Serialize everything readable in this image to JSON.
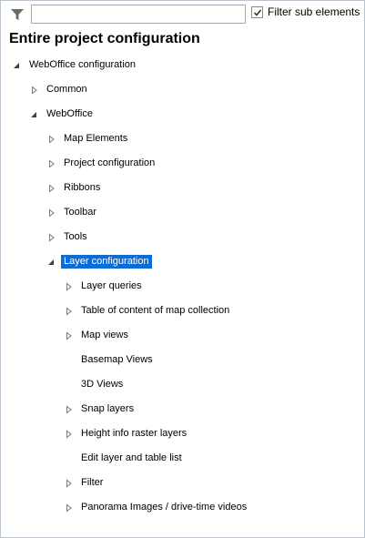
{
  "filter": {
    "placeholder": "",
    "value": "",
    "sub_elements_label": "Filter sub elements",
    "sub_elements_checked": true
  },
  "heading": "Entire project configuration",
  "tree": [
    {
      "label": "WebOffice configuration",
      "depth": 0,
      "state": "expanded",
      "selected": false
    },
    {
      "label": "Common",
      "depth": 1,
      "state": "collapsed",
      "selected": false
    },
    {
      "label": "WebOffice",
      "depth": 1,
      "state": "expanded",
      "selected": false
    },
    {
      "label": "Map Elements",
      "depth": 2,
      "state": "collapsed",
      "selected": false
    },
    {
      "label": "Project configuration",
      "depth": 2,
      "state": "collapsed",
      "selected": false
    },
    {
      "label": "Ribbons",
      "depth": 2,
      "state": "collapsed",
      "selected": false
    },
    {
      "label": "Toolbar",
      "depth": 2,
      "state": "collapsed",
      "selected": false
    },
    {
      "label": "Tools",
      "depth": 2,
      "state": "collapsed",
      "selected": false
    },
    {
      "label": "Layer configuration",
      "depth": 2,
      "state": "expanded",
      "selected": true
    },
    {
      "label": "Layer queries",
      "depth": 3,
      "state": "collapsed",
      "selected": false
    },
    {
      "label": "Table of content of map collection",
      "depth": 3,
      "state": "collapsed",
      "selected": false
    },
    {
      "label": "Map views",
      "depth": 3,
      "state": "collapsed",
      "selected": false
    },
    {
      "label": "Basemap Views",
      "depth": 3,
      "state": "leaf",
      "selected": false
    },
    {
      "label": "3D Views",
      "depth": 3,
      "state": "leaf",
      "selected": false
    },
    {
      "label": "Snap layers",
      "depth": 3,
      "state": "collapsed",
      "selected": false
    },
    {
      "label": "Height info raster layers",
      "depth": 3,
      "state": "collapsed",
      "selected": false
    },
    {
      "label": "Edit layer and table list",
      "depth": 3,
      "state": "leaf",
      "selected": false
    },
    {
      "label": "Filter",
      "depth": 3,
      "state": "collapsed",
      "selected": false
    },
    {
      "label": "Panorama Images / drive-time videos",
      "depth": 3,
      "state": "collapsed",
      "selected": false
    }
  ],
  "icons": {
    "filter": "funnel-icon",
    "collapsed": "triangle-right-icon",
    "expanded": "triangle-down-right-icon"
  },
  "colors": {
    "selection": "#0a6cd6",
    "frame_border": "#b9c4cf",
    "icon_gray": "#6b6b6b"
  }
}
